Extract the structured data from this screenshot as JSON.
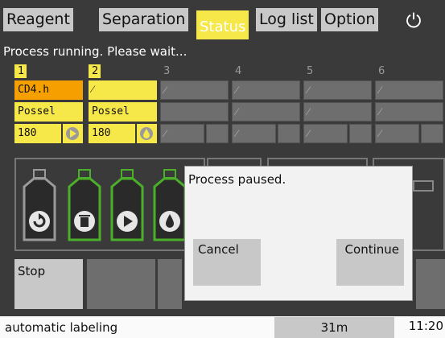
{
  "tabs": [
    {
      "label": "Reagent",
      "active": false
    },
    {
      "label": "Separation",
      "active": false
    },
    {
      "label": "Status",
      "active": true
    },
    {
      "label": "Log list",
      "active": false
    },
    {
      "label": "Option",
      "active": false
    }
  ],
  "power_icon": "power-icon",
  "status_message": "Process running. Please wait...",
  "slots": [
    {
      "number": "1",
      "reagent": "CD4.h",
      "fluid": "Possel",
      "volume": "180"
    },
    {
      "number": "2",
      "reagent": "⁄",
      "fluid": "Possel",
      "volume": "180"
    },
    {
      "number": "3",
      "reagent": "⁄",
      "fluid": "",
      "volume": "⁄"
    },
    {
      "number": "4",
      "reagent": "⁄",
      "fluid": "⁄",
      "volume": "⁄"
    },
    {
      "number": "5",
      "reagent": "⁄",
      "fluid": "⁄",
      "volume": "⁄"
    },
    {
      "number": "6",
      "reagent": "⁄",
      "fluid": "⁄",
      "volume": "⁄"
    }
  ],
  "bottle_icons": [
    "recycle-icon",
    "trash-icon",
    "play-icon",
    "drop-icon"
  ],
  "controls": {
    "stop_label": "Stop"
  },
  "dialog": {
    "message": "Process paused.",
    "cancel_label": "Cancel",
    "continue_label": "Continue"
  },
  "footer": {
    "mode": "automatic labeling",
    "remaining": "31m",
    "clock": "11:20"
  },
  "colors": {
    "accent": "#f7e84a",
    "highlight": "#f5a000",
    "bottle_green": "#4caf2a"
  }
}
